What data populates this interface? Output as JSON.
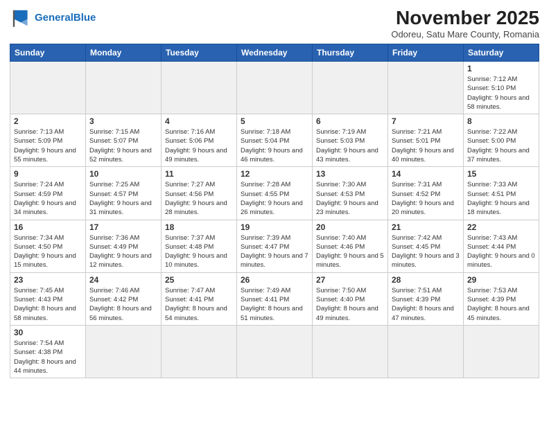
{
  "header": {
    "logo_general": "General",
    "logo_blue": "Blue",
    "month_title": "November 2025",
    "location": "Odoreu, Satu Mare County, Romania"
  },
  "weekdays": [
    "Sunday",
    "Monday",
    "Tuesday",
    "Wednesday",
    "Thursday",
    "Friday",
    "Saturday"
  ],
  "weeks": [
    [
      {
        "day": "",
        "info": "",
        "empty": true
      },
      {
        "day": "",
        "info": "",
        "empty": true
      },
      {
        "day": "",
        "info": "",
        "empty": true
      },
      {
        "day": "",
        "info": "",
        "empty": true
      },
      {
        "day": "",
        "info": "",
        "empty": true
      },
      {
        "day": "",
        "info": "",
        "empty": true
      },
      {
        "day": "1",
        "info": "Sunrise: 7:12 AM\nSunset: 5:10 PM\nDaylight: 9 hours\nand 58 minutes.",
        "empty": false
      }
    ],
    [
      {
        "day": "2",
        "info": "Sunrise: 7:13 AM\nSunset: 5:09 PM\nDaylight: 9 hours\nand 55 minutes.",
        "empty": false
      },
      {
        "day": "3",
        "info": "Sunrise: 7:15 AM\nSunset: 5:07 PM\nDaylight: 9 hours\nand 52 minutes.",
        "empty": false
      },
      {
        "day": "4",
        "info": "Sunrise: 7:16 AM\nSunset: 5:06 PM\nDaylight: 9 hours\nand 49 minutes.",
        "empty": false
      },
      {
        "day": "5",
        "info": "Sunrise: 7:18 AM\nSunset: 5:04 PM\nDaylight: 9 hours\nand 46 minutes.",
        "empty": false
      },
      {
        "day": "6",
        "info": "Sunrise: 7:19 AM\nSunset: 5:03 PM\nDaylight: 9 hours\nand 43 minutes.",
        "empty": false
      },
      {
        "day": "7",
        "info": "Sunrise: 7:21 AM\nSunset: 5:01 PM\nDaylight: 9 hours\nand 40 minutes.",
        "empty": false
      },
      {
        "day": "8",
        "info": "Sunrise: 7:22 AM\nSunset: 5:00 PM\nDaylight: 9 hours\nand 37 minutes.",
        "empty": false
      }
    ],
    [
      {
        "day": "9",
        "info": "Sunrise: 7:24 AM\nSunset: 4:59 PM\nDaylight: 9 hours\nand 34 minutes.",
        "empty": false
      },
      {
        "day": "10",
        "info": "Sunrise: 7:25 AM\nSunset: 4:57 PM\nDaylight: 9 hours\nand 31 minutes.",
        "empty": false
      },
      {
        "day": "11",
        "info": "Sunrise: 7:27 AM\nSunset: 4:56 PM\nDaylight: 9 hours\nand 28 minutes.",
        "empty": false
      },
      {
        "day": "12",
        "info": "Sunrise: 7:28 AM\nSunset: 4:55 PM\nDaylight: 9 hours\nand 26 minutes.",
        "empty": false
      },
      {
        "day": "13",
        "info": "Sunrise: 7:30 AM\nSunset: 4:53 PM\nDaylight: 9 hours\nand 23 minutes.",
        "empty": false
      },
      {
        "day": "14",
        "info": "Sunrise: 7:31 AM\nSunset: 4:52 PM\nDaylight: 9 hours\nand 20 minutes.",
        "empty": false
      },
      {
        "day": "15",
        "info": "Sunrise: 7:33 AM\nSunset: 4:51 PM\nDaylight: 9 hours\nand 18 minutes.",
        "empty": false
      }
    ],
    [
      {
        "day": "16",
        "info": "Sunrise: 7:34 AM\nSunset: 4:50 PM\nDaylight: 9 hours\nand 15 minutes.",
        "empty": false
      },
      {
        "day": "17",
        "info": "Sunrise: 7:36 AM\nSunset: 4:49 PM\nDaylight: 9 hours\nand 12 minutes.",
        "empty": false
      },
      {
        "day": "18",
        "info": "Sunrise: 7:37 AM\nSunset: 4:48 PM\nDaylight: 9 hours\nand 10 minutes.",
        "empty": false
      },
      {
        "day": "19",
        "info": "Sunrise: 7:39 AM\nSunset: 4:47 PM\nDaylight: 9 hours\nand 7 minutes.",
        "empty": false
      },
      {
        "day": "20",
        "info": "Sunrise: 7:40 AM\nSunset: 4:46 PM\nDaylight: 9 hours\nand 5 minutes.",
        "empty": false
      },
      {
        "day": "21",
        "info": "Sunrise: 7:42 AM\nSunset: 4:45 PM\nDaylight: 9 hours\nand 3 minutes.",
        "empty": false
      },
      {
        "day": "22",
        "info": "Sunrise: 7:43 AM\nSunset: 4:44 PM\nDaylight: 9 hours\nand 0 minutes.",
        "empty": false
      }
    ],
    [
      {
        "day": "23",
        "info": "Sunrise: 7:45 AM\nSunset: 4:43 PM\nDaylight: 8 hours\nand 58 minutes.",
        "empty": false
      },
      {
        "day": "24",
        "info": "Sunrise: 7:46 AM\nSunset: 4:42 PM\nDaylight: 8 hours\nand 56 minutes.",
        "empty": false
      },
      {
        "day": "25",
        "info": "Sunrise: 7:47 AM\nSunset: 4:41 PM\nDaylight: 8 hours\nand 54 minutes.",
        "empty": false
      },
      {
        "day": "26",
        "info": "Sunrise: 7:49 AM\nSunset: 4:41 PM\nDaylight: 8 hours\nand 51 minutes.",
        "empty": false
      },
      {
        "day": "27",
        "info": "Sunrise: 7:50 AM\nSunset: 4:40 PM\nDaylight: 8 hours\nand 49 minutes.",
        "empty": false
      },
      {
        "day": "28",
        "info": "Sunrise: 7:51 AM\nSunset: 4:39 PM\nDaylight: 8 hours\nand 47 minutes.",
        "empty": false
      },
      {
        "day": "29",
        "info": "Sunrise: 7:53 AM\nSunset: 4:39 PM\nDaylight: 8 hours\nand 45 minutes.",
        "empty": false
      }
    ],
    [
      {
        "day": "30",
        "info": "Sunrise: 7:54 AM\nSunset: 4:38 PM\nDaylight: 8 hours\nand 44 minutes.",
        "empty": false
      },
      {
        "day": "",
        "info": "",
        "empty": true
      },
      {
        "day": "",
        "info": "",
        "empty": true
      },
      {
        "day": "",
        "info": "",
        "empty": true
      },
      {
        "day": "",
        "info": "",
        "empty": true
      },
      {
        "day": "",
        "info": "",
        "empty": true
      },
      {
        "day": "",
        "info": "",
        "empty": true
      }
    ]
  ]
}
